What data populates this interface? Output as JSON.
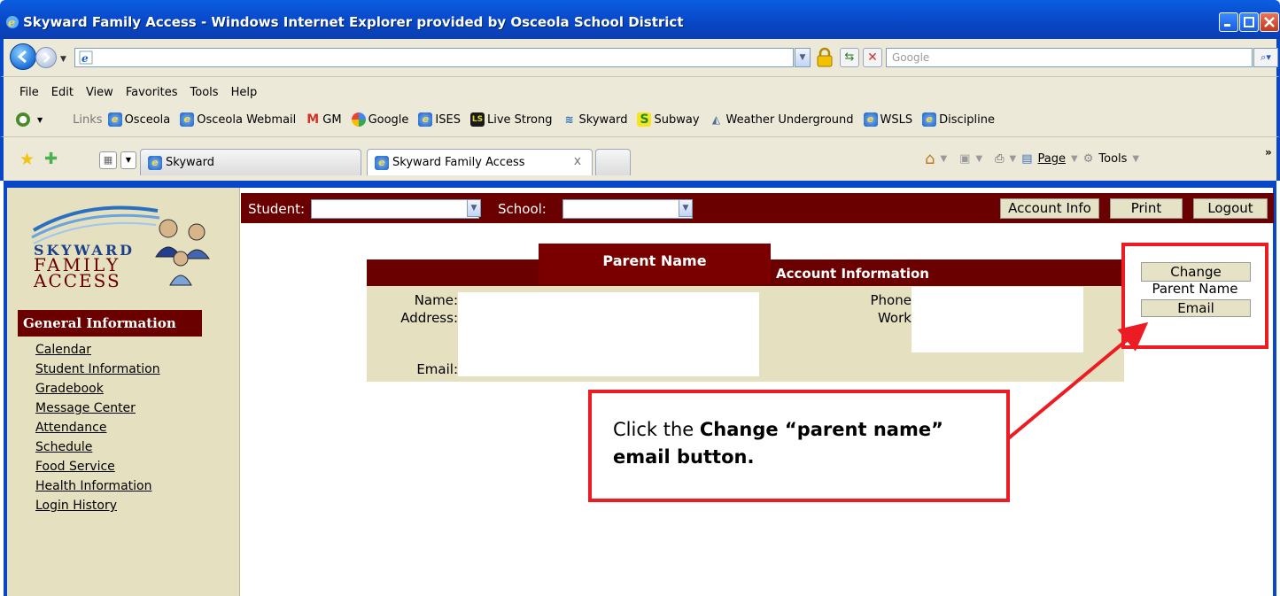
{
  "window": {
    "title": "Skyward Family Access - Windows Internet Explorer provided by Osceola School District"
  },
  "address_bar": {
    "url": "",
    "search_placeholder": "Google"
  },
  "menu": [
    "File",
    "Edit",
    "View",
    "Favorites",
    "Tools",
    "Help"
  ],
  "links": {
    "label": "Links",
    "items": [
      "Osceola",
      "Osceola Webmail",
      "GM",
      "Google",
      "ISES",
      "Live Strong",
      "Skyward",
      "Subway",
      "Weather Underground",
      "WSLS",
      "Discipline"
    ]
  },
  "tabs": [
    {
      "label": "Skyward"
    },
    {
      "label": "Skyward Family Access",
      "close": "x"
    }
  ],
  "command_bar": {
    "page": "Page",
    "tools": "Tools"
  },
  "sidebar": {
    "header": "General Information",
    "items": [
      "Calendar",
      "Student Information",
      "Gradebook",
      "Message Center",
      "Attendance",
      "Schedule",
      "Food Service",
      "Health Information",
      "Login History"
    ]
  },
  "topbar": {
    "student_label": "Student:",
    "school_label": "School:",
    "account_info": "Account Info",
    "print": "Print",
    "logout": "Logout"
  },
  "account": {
    "title": "Account Information",
    "name_label": "Name:",
    "address_label": "Address:",
    "email_label": "Email:",
    "phone_label": "Phone:",
    "work_label": "Work:"
  },
  "annotation": {
    "banner": "Parent Name",
    "change_button": "Change",
    "parent_name": "Parent Name",
    "email_button": "Email",
    "instruction_prefix": "Click the ",
    "instruction_bold": "Change “parent name” email button."
  },
  "colors": {
    "maroon": "#6b0000",
    "sidebar_bg": "#e4e0c0",
    "callout_red": "#ed1c24",
    "xp_blue": "#0847c8"
  }
}
